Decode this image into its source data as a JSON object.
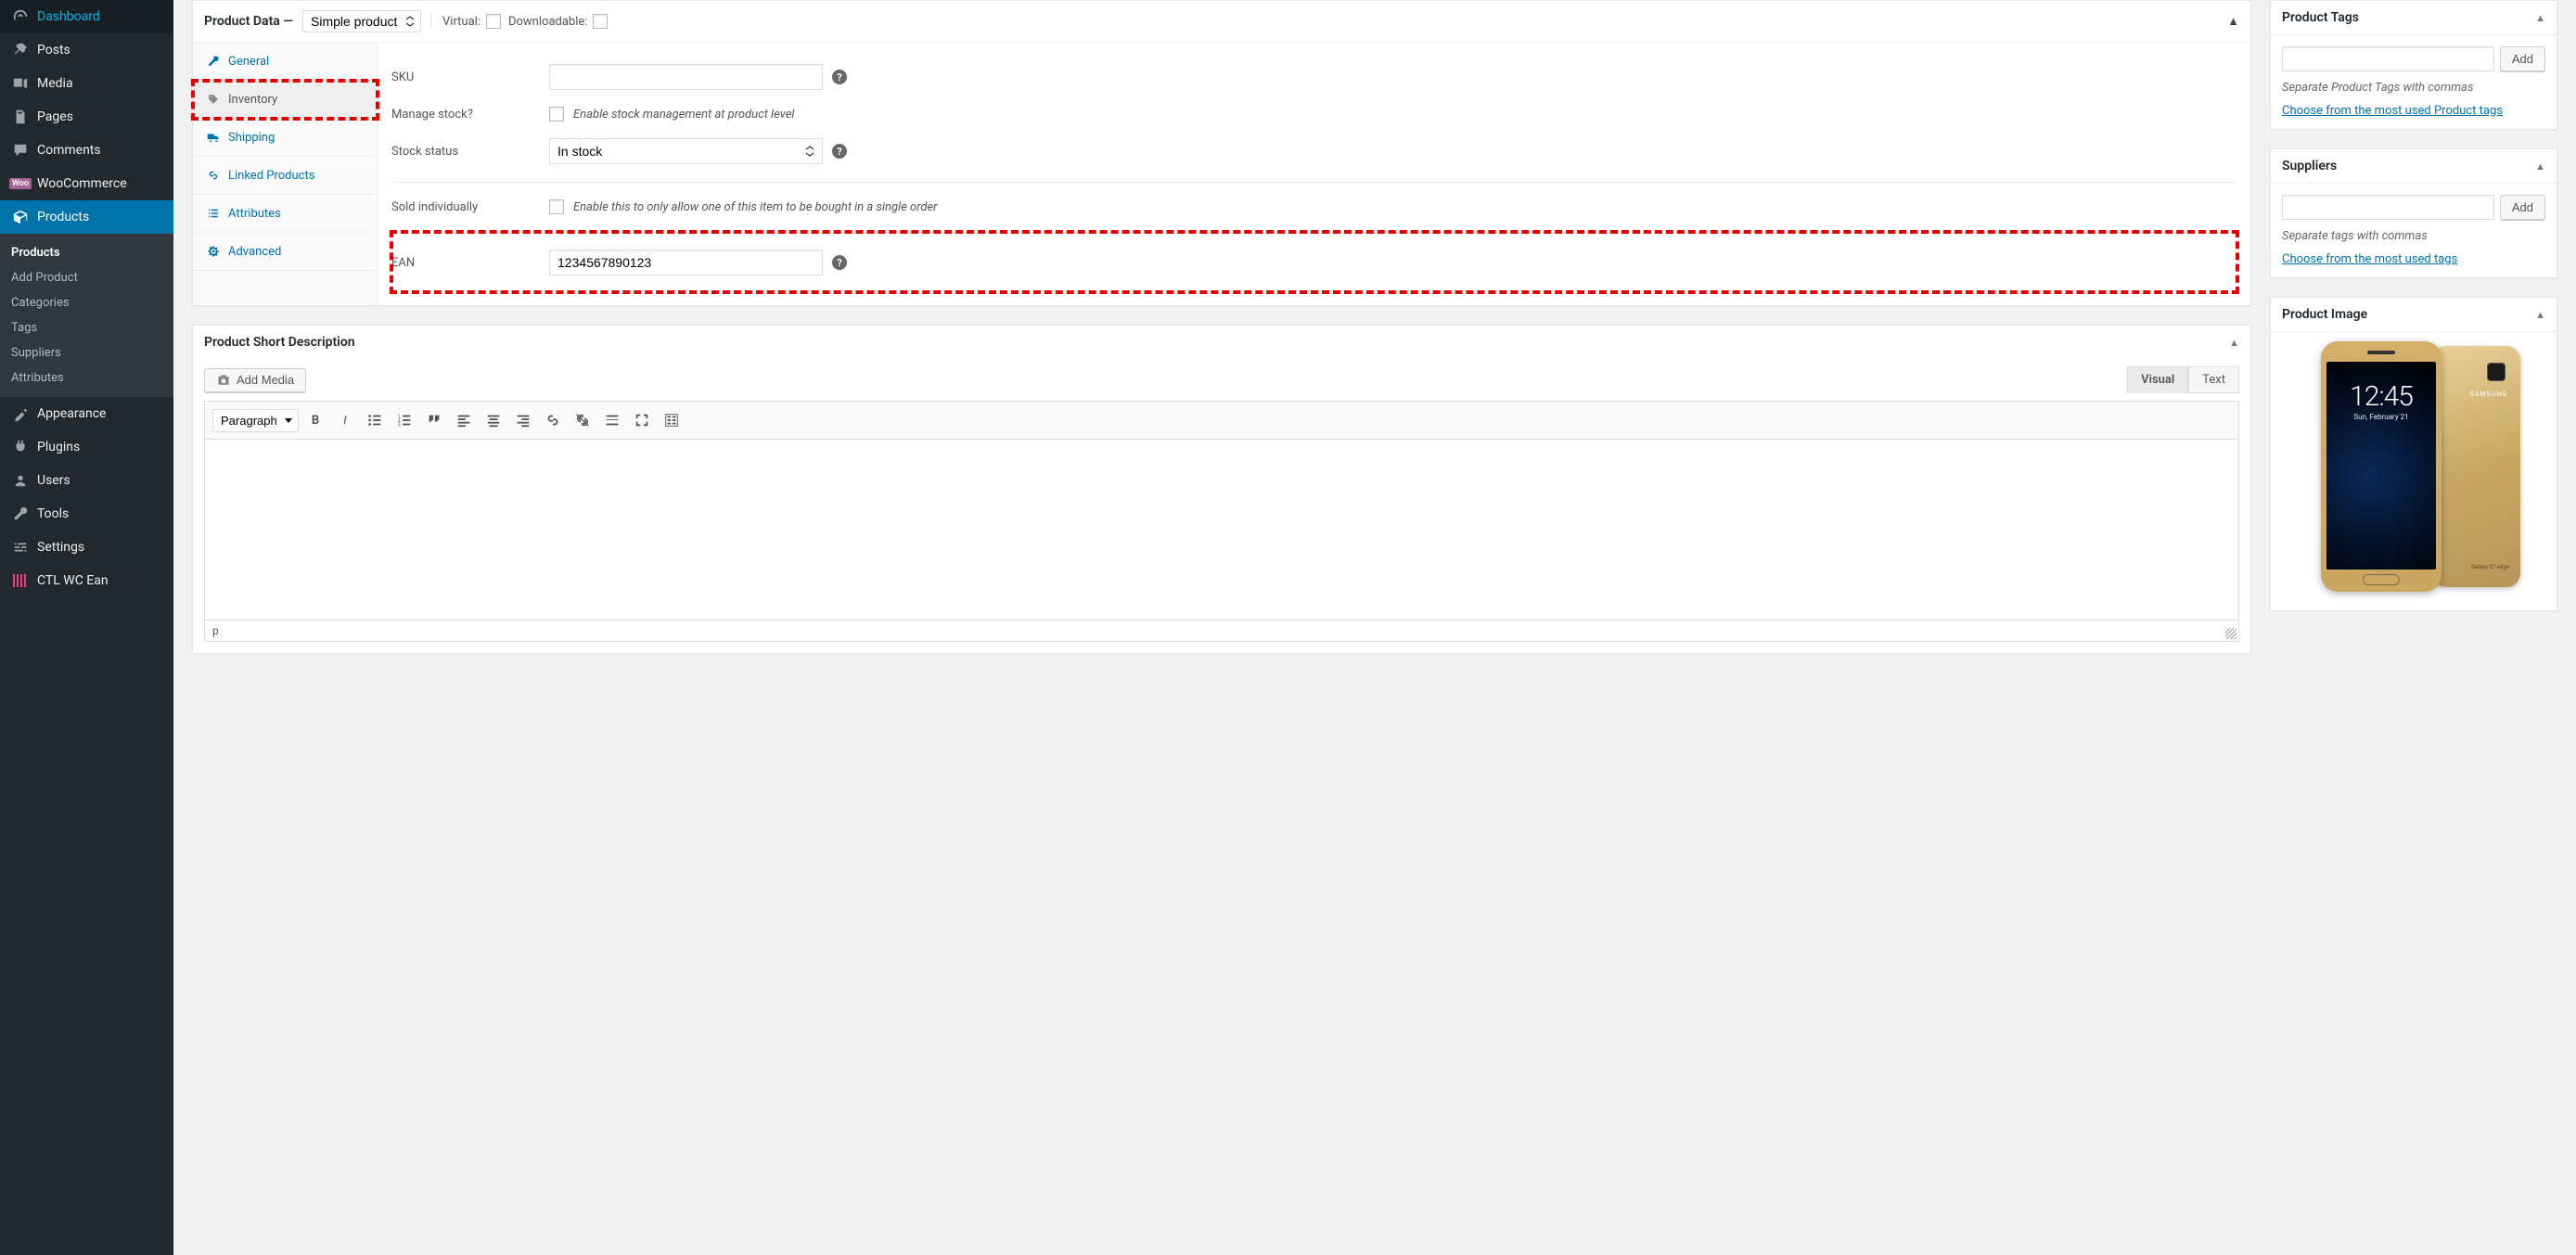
{
  "sidebar": {
    "items": [
      {
        "label": "Dashboard"
      },
      {
        "label": "Posts"
      },
      {
        "label": "Media"
      },
      {
        "label": "Pages"
      },
      {
        "label": "Comments"
      },
      {
        "label": "WooCommerce"
      },
      {
        "label": "Products"
      },
      {
        "label": "Appearance"
      },
      {
        "label": "Plugins"
      },
      {
        "label": "Users"
      },
      {
        "label": "Tools"
      },
      {
        "label": "Settings"
      },
      {
        "label": "CTL WC Ean"
      }
    ],
    "submenu": [
      {
        "label": "Products"
      },
      {
        "label": "Add Product"
      },
      {
        "label": "Categories"
      },
      {
        "label": "Tags"
      },
      {
        "label": "Suppliers"
      },
      {
        "label": "Attributes"
      }
    ]
  },
  "product_data": {
    "title_prefix": "Product Data —",
    "type_selected": "Simple product",
    "virtual_label": "Virtual:",
    "downloadable_label": "Downloadable:",
    "tabs": {
      "general": "General",
      "inventory": "Inventory",
      "shipping": "Shipping",
      "linked": "Linked Products",
      "attributes": "Attributes",
      "advanced": "Advanced"
    },
    "fields": {
      "sku_label": "SKU",
      "sku_value": "",
      "manage_stock_label": "Manage stock?",
      "manage_stock_desc": "Enable stock management at product level",
      "stock_status_label": "Stock status",
      "stock_status_value": "In stock",
      "sold_individually_label": "Sold individually",
      "sold_individually_desc": "Enable this to only allow one of this item to be bought in a single order",
      "ean_label": "EAN",
      "ean_value": "1234567890123"
    }
  },
  "short_desc": {
    "title": "Product Short Description",
    "add_media": "Add Media",
    "visual_tab": "Visual",
    "text_tab": "Text",
    "format": "Paragraph",
    "status_path": "p"
  },
  "widgets": {
    "product_tags": {
      "title": "Product Tags",
      "add": "Add",
      "help": "Separate Product Tags with commas",
      "link": "Choose from the most used Product tags"
    },
    "suppliers": {
      "title": "Suppliers",
      "add": "Add",
      "help": "Separate tags with commas",
      "link": "Choose from the most used tags"
    },
    "product_image": {
      "title": "Product Image",
      "clock": "12:45",
      "date": "Sun, February 21",
      "brand": "SAMSUNG",
      "model": "Galaxy S7 edge"
    }
  }
}
